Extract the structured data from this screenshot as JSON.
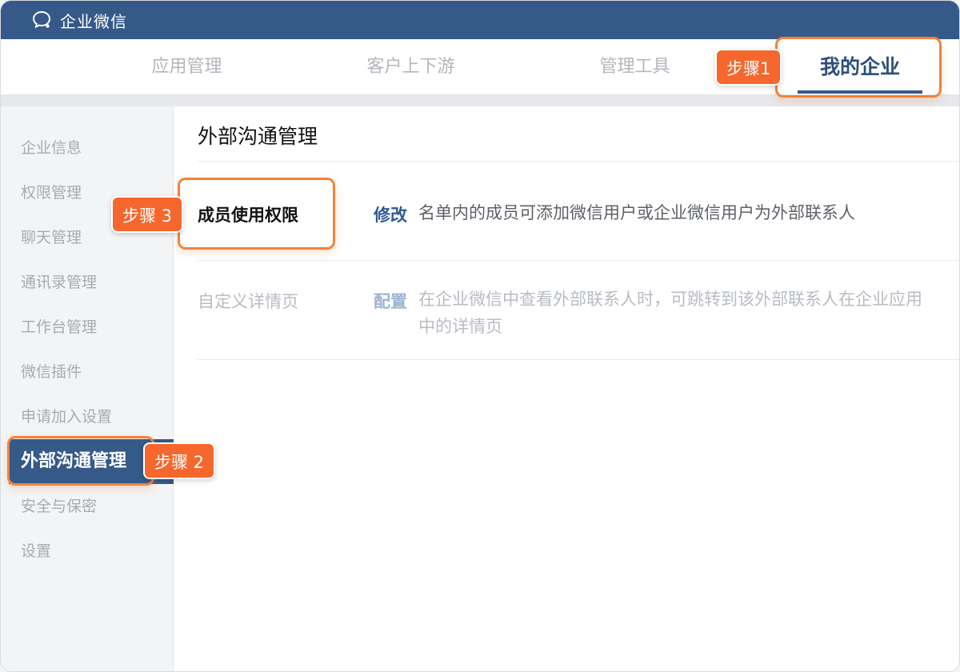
{
  "app": {
    "title": "企业微信",
    "logo_icon": "wecom-logo-icon"
  },
  "topnav": {
    "tabs": [
      {
        "label": "应用管理"
      },
      {
        "label": "客户上下游"
      },
      {
        "label": "管理工具"
      },
      {
        "label": "我的企业",
        "active": true
      }
    ]
  },
  "sidebar": {
    "items": [
      {
        "label": "企业信息"
      },
      {
        "label": "权限管理"
      },
      {
        "label": "聊天管理"
      },
      {
        "label": "通讯录管理"
      },
      {
        "label": "工作台管理"
      },
      {
        "label": "微信插件"
      },
      {
        "label": "申请加入设置"
      },
      {
        "label": "外部沟通管理",
        "active": true
      },
      {
        "label": "安全与保密"
      },
      {
        "label": "设置"
      }
    ]
  },
  "main": {
    "title": "外部沟通管理",
    "rows": [
      {
        "label": "成员使用权限",
        "action": "修改",
        "description": "名单内的成员可添加微信用户或企业微信用户为外部联系人"
      },
      {
        "label": "自定义详情页",
        "action": "配置",
        "description": "在企业微信中查看外部联系人时，可跳转到该外部联系人在企业应用中的详情页"
      }
    ]
  },
  "annotations": {
    "step1": "步骤1",
    "step2": "步骤 2",
    "step3": "步骤 3"
  },
  "colors": {
    "brand": "#355a89",
    "highlight": "#f3823a",
    "step_badge": "#f5672d",
    "link": "#2f5b93"
  }
}
